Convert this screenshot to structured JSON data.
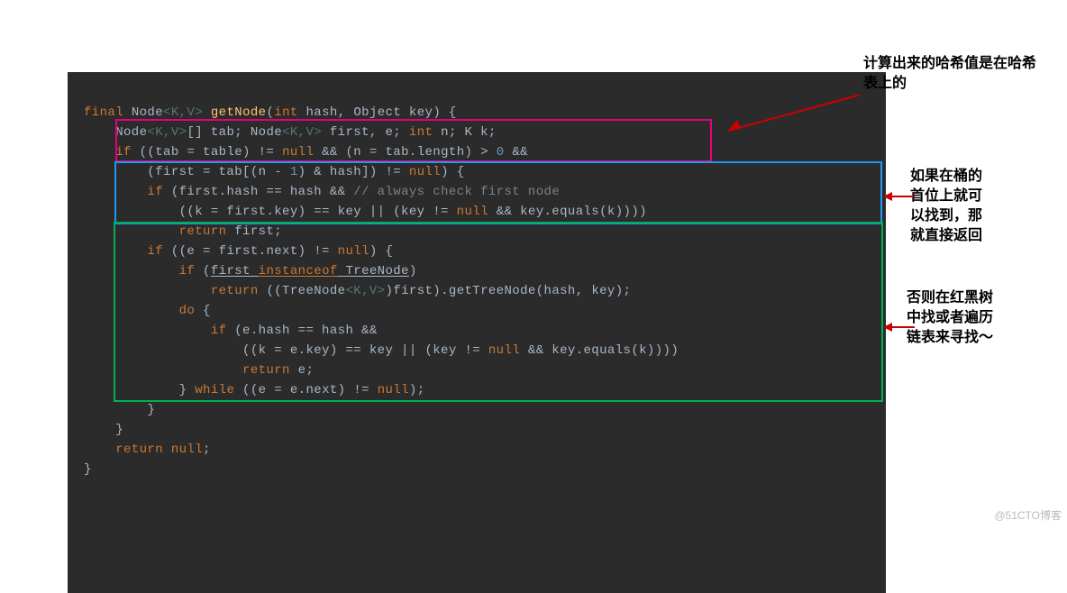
{
  "code": {
    "l1": {
      "p1": "final",
      "p2": " Node",
      "p3": "<K,V>",
      "p4": " ",
      "p5": "getNode",
      "p6": "(",
      "p7": "int",
      "p8": " hash, Object key) {"
    },
    "l2": {
      "p1": "    Node",
      "p2": "<K,V>",
      "p3": "[] tab; Node",
      "p4": "<K,V>",
      "p5": " first, e; ",
      "p6": "int",
      "p7": " n; K k;"
    },
    "l3": {
      "p1": "    ",
      "p2": "if",
      "p3": " ((tab = table) != ",
      "p4": "null",
      "p5": " && (n = tab.length) > ",
      "p6": "0",
      "p7": " &&"
    },
    "l4": {
      "p1": "        (first = tab[(n - ",
      "p2": "1",
      "p3": ") & hash]) != ",
      "p4": "null",
      "p5": ") {"
    },
    "l5": {
      "p1": "        ",
      "p2": "if",
      "p3": " (first.hash == hash && ",
      "p4": "// always check first node"
    },
    "l6": {
      "p1": "            ((k = first.key) == key || (key != ",
      "p2": "null",
      "p3": " && key.equals(k))))"
    },
    "l7": {
      "p1": "            ",
      "p2": "return",
      "p3": " first;"
    },
    "l8": {
      "p1": "        ",
      "p2": "if",
      "p3": " ((e = first.next) != ",
      "p4": "null",
      "p5": ") {"
    },
    "l9": {
      "p1": "            ",
      "p2": "if",
      "p3": " (",
      "p4": "first ",
      "p5": "instanceof",
      "p6": " TreeNode",
      "p7": ")"
    },
    "l10": {
      "p1": "                ",
      "p2": "return",
      "p3": " ((TreeNode",
      "p4": "<K,V>",
      "p5": ")first).getTreeNode(hash, key);"
    },
    "l11": {
      "p1": "            ",
      "p2": "do",
      "p3": " {"
    },
    "l12": {
      "p1": "                ",
      "p2": "if",
      "p3": " (e.hash == hash &&"
    },
    "l13": {
      "p1": "                    ((k = e.key) == key || (key != ",
      "p2": "null",
      "p3": " && key.equals(k))))"
    },
    "l14": {
      "p1": "                    ",
      "p2": "return",
      "p3": " e;"
    },
    "l15": {
      "p1": "            } ",
      "p2": "while",
      "p3": " ((e = e.next) != ",
      "p4": "null",
      "p5": ");"
    },
    "l16": {
      "p1": "        }"
    },
    "l17": {
      "p1": "    }"
    },
    "l18": {
      "p1": "    ",
      "p2": "return null",
      "p3": ";"
    },
    "l19": {
      "p1": "}"
    }
  },
  "annotations": {
    "a1": "计算出来的哈希值是在哈希\n表上的",
    "a2": "如果在桶的\n首位上就可\n以找到，那\n就直接返回",
    "a3": "否则在红黑树\n中找或者遍历\n链表来寻找～"
  },
  "watermark": "@51CTO博客"
}
